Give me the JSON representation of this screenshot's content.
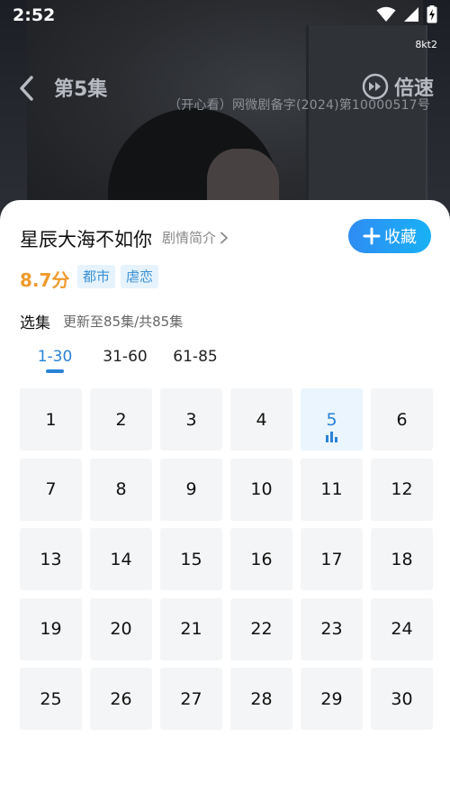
{
  "status_bar": {
    "time": "2:52",
    "icons": [
      "wifi-icon",
      "signal-icon",
      "battery-charging-icon"
    ]
  },
  "video": {
    "code": "8kt2",
    "episode_title": "第5集",
    "speed_label": "倍速",
    "license": "（开心看）网微剧备字(2024)第10000517号"
  },
  "drama": {
    "title": "星辰大海不如你",
    "synopsis_label": "剧情简介",
    "collect_label": "收藏",
    "rating": "8.7分",
    "tags": [
      "都市",
      "虐恋"
    ],
    "select_label": "选集",
    "update_info": "更新至85集/共85集"
  },
  "range_tabs": [
    "1-30",
    "31-60",
    "61-85"
  ],
  "active_range": "1-30",
  "episodes": [
    "1",
    "2",
    "3",
    "4",
    "5",
    "6",
    "7",
    "8",
    "9",
    "10",
    "11",
    "12",
    "13",
    "14",
    "15",
    "16",
    "17",
    "18",
    "19",
    "20",
    "21",
    "22",
    "23",
    "24",
    "25",
    "26",
    "27",
    "28",
    "29",
    "30"
  ],
  "current_episode": "5",
  "colors": {
    "accent": "#2a82d8",
    "rating": "#f09a2c",
    "collect_gradient_start": "#2f8cf3",
    "collect_gradient_end": "#18b1f5"
  }
}
